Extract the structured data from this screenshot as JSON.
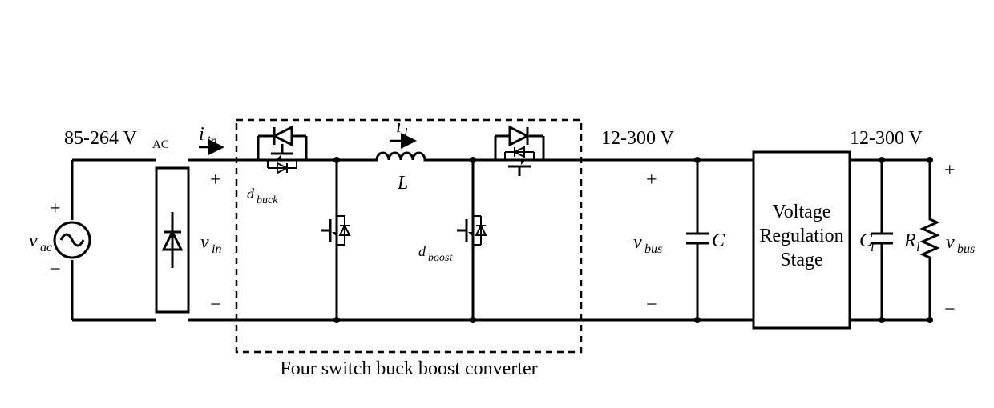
{
  "labels": {
    "vac_range": "85-264 V",
    "vac_suffix": "AC",
    "vac": "v",
    "vac_sub": "ac",
    "iin": "i",
    "iin_sub": "in",
    "vin": "v",
    "vin_sub": "in",
    "il": "i",
    "il_sub": "l",
    "L": "L",
    "dbuck": "d",
    "dbuck_sub": "buck",
    "dboost": "d",
    "dboost_sub": "boost",
    "vbus": "v",
    "vbus_sub": "bus",
    "C": "C",
    "Cl": "C",
    "Cl_sub": "l",
    "Rl": "R",
    "Rl_sub": "l",
    "bus_range_left": "12-300 V",
    "bus_range_right": "12-300 V",
    "reg_line1": "Voltage",
    "reg_line2": "Regulation",
    "reg_line3": "Stage",
    "caption": "Four switch buck boost converter",
    "plus": "+",
    "minus": "−"
  }
}
